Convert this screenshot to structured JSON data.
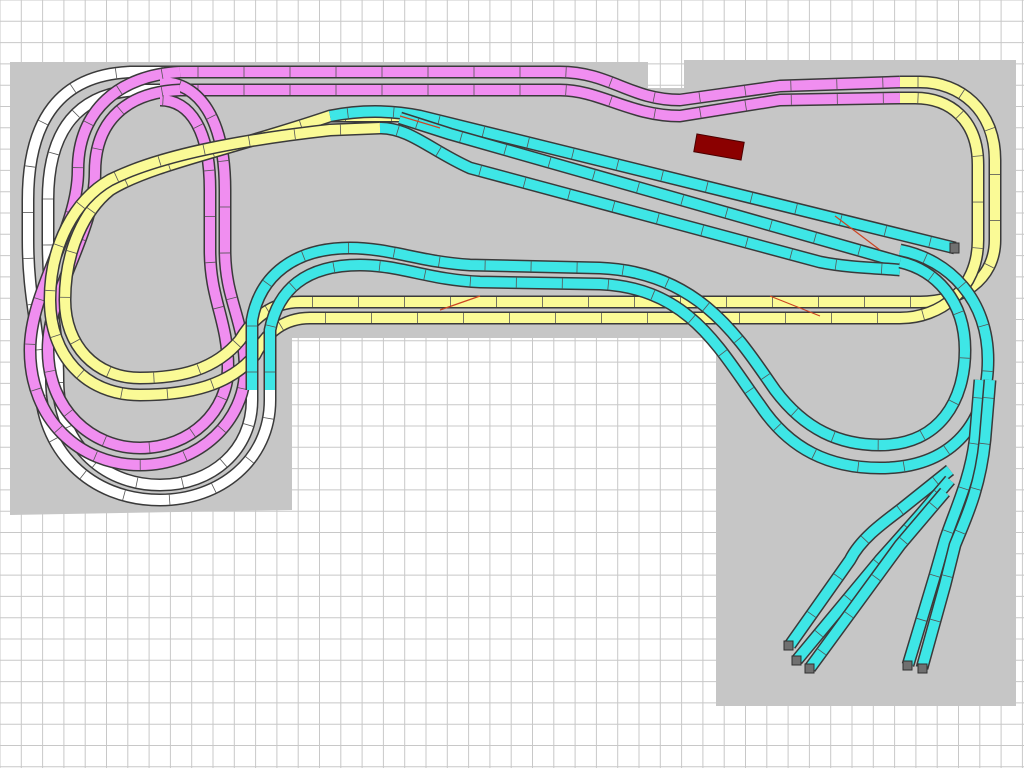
{
  "colors": {
    "background": "#ffffff",
    "grid": "#c8c8c8",
    "baseboard": "#c6c6c6",
    "rail": "#3a3a3a",
    "route_white": "#ffffff",
    "route_pink": "#f08ef0",
    "route_yellow": "#fafa96",
    "route_cyan": "#3ee6e6",
    "building": "#8b0000"
  },
  "legend_icons": [
    "track-segment",
    "buffer-stop-icon",
    "building-block"
  ],
  "tracks": [
    {
      "name": "outer-white-loop-a",
      "route": "white"
    },
    {
      "name": "outer-white-loop-b",
      "route": "white"
    },
    {
      "name": "pink-main-outer",
      "route": "pink"
    },
    {
      "name": "pink-main-inner",
      "route": "pink"
    },
    {
      "name": "pink-figure-eight-a",
      "route": "pink"
    },
    {
      "name": "pink-figure-eight-b",
      "route": "pink"
    },
    {
      "name": "yellow-main-upper",
      "route": "yellow"
    },
    {
      "name": "yellow-main-lower",
      "route": "yellow"
    },
    {
      "name": "yellow-east-return",
      "route": "yellow"
    },
    {
      "name": "cyan-yard-1",
      "route": "cyan"
    },
    {
      "name": "cyan-yard-2",
      "route": "cyan"
    },
    {
      "name": "cyan-yard-3",
      "route": "cyan"
    },
    {
      "name": "cyan-inner-loop-a",
      "route": "cyan"
    },
    {
      "name": "cyan-inner-loop-b",
      "route": "cyan"
    },
    {
      "name": "cyan-fan-1",
      "route": "cyan"
    },
    {
      "name": "cyan-fan-2",
      "route": "cyan"
    },
    {
      "name": "cyan-fan-3",
      "route": "cyan"
    },
    {
      "name": "cyan-fan-4",
      "route": "cyan"
    },
    {
      "name": "cyan-fan-5",
      "route": "cyan"
    }
  ]
}
